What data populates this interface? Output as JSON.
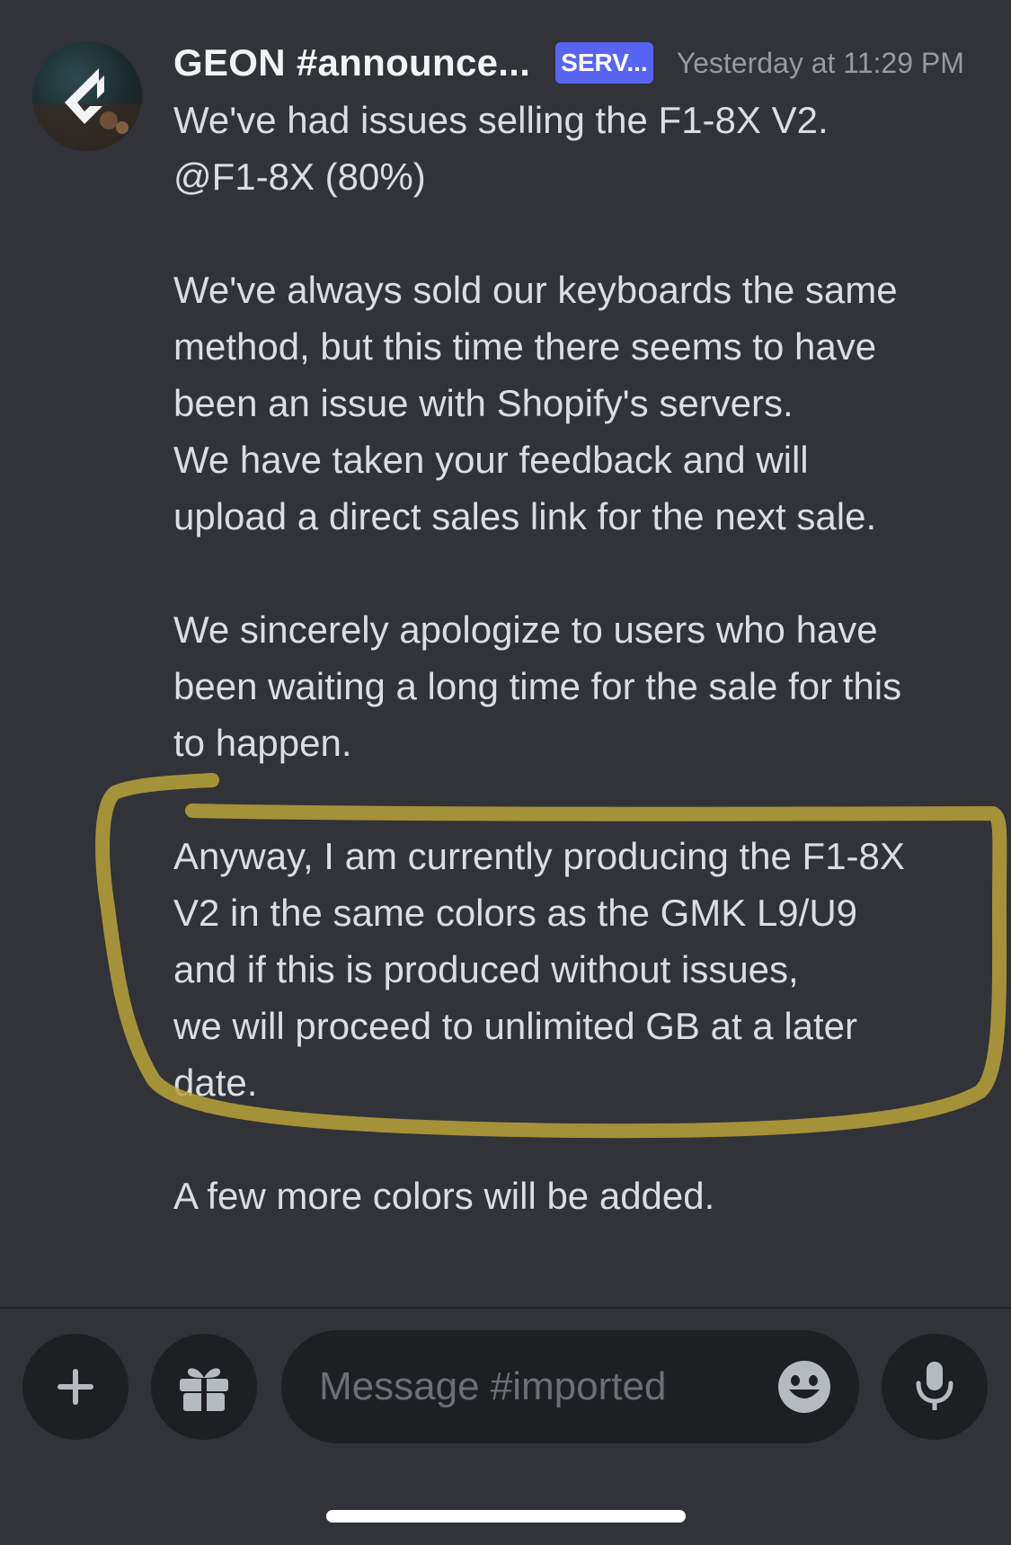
{
  "message": {
    "author": "GEON #announce...",
    "server_tag": "SERV...",
    "timestamp": "Yesterday at 11:29 PM",
    "lines": [
      "We've had issues selling the F1-8X V2.",
      "@F1-8X (80%)",
      "",
      "We've always sold our keyboards the same",
      "method, but this time there seems to have",
      "been an issue with Shopify's servers.",
      "We have taken your feedback and will",
      "upload a direct sales link for the next sale.",
      "",
      "We sincerely apologize to users who have",
      "been waiting a long time for the sale for this",
      "to happen.",
      "",
      "Anyway, I am currently producing the F1-8X",
      "V2 in the same colors as the GMK L9/U9",
      "and if this is produced without issues,",
      "we will proceed to unlimited GB at a later",
      "date.",
      "",
      "A few more colors will be added."
    ]
  },
  "composer": {
    "placeholder": "Message #imported",
    "icons": {
      "add": "plus-icon",
      "gift": "gift-icon",
      "emoji": "smile-emoji-icon",
      "voice": "microphone-icon"
    }
  },
  "colors": {
    "background": "#313338",
    "input_background": "#1e1f22",
    "server_tag": "#5865f2",
    "highlight_marker": "#b8a33a"
  }
}
